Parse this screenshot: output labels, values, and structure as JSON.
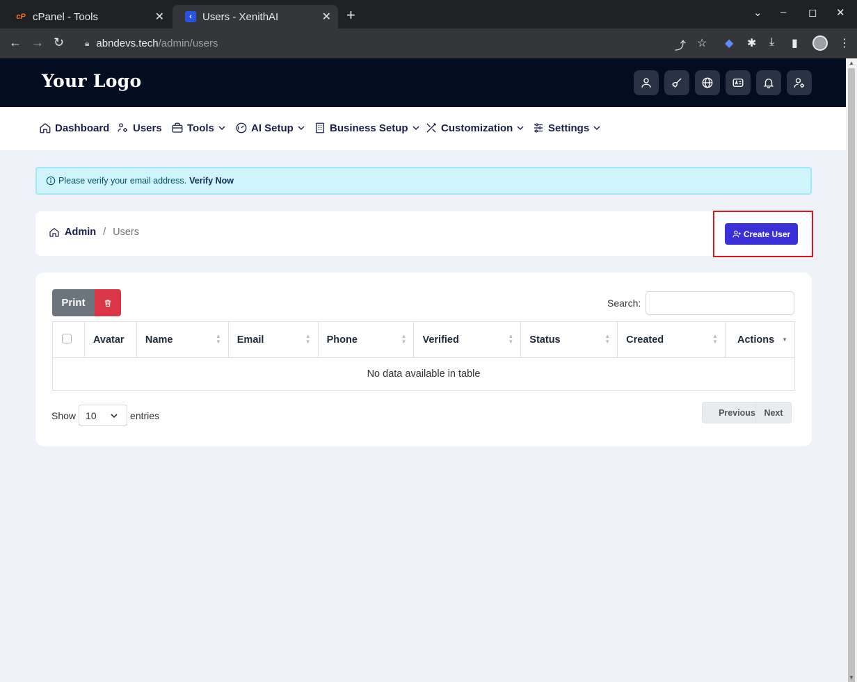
{
  "browser": {
    "tabs": [
      {
        "title": "cPanel - Tools",
        "favicon": "cpanel-icon"
      },
      {
        "title": "Users - XenithAI",
        "favicon": "xenith-icon"
      }
    ],
    "url_host": "abndevs.tech",
    "url_path": "/admin/users"
  },
  "header": {
    "logo": "Your Logo",
    "icons": [
      "user-icon",
      "broom-icon",
      "globe-icon",
      "language-icon",
      "bell-icon",
      "user-settings-icon"
    ]
  },
  "nav": {
    "items": [
      {
        "label": "Dashboard",
        "icon": "home-icon",
        "dropdown": false
      },
      {
        "label": "Users",
        "icon": "users-gear-icon",
        "dropdown": false
      },
      {
        "label": "Tools",
        "icon": "briefcase-icon",
        "dropdown": true
      },
      {
        "label": "AI Setup",
        "icon": "gauge-icon",
        "dropdown": true
      },
      {
        "label": "Business Setup",
        "icon": "building-icon",
        "dropdown": true
      },
      {
        "label": "Customization",
        "icon": "tools-icon",
        "dropdown": true
      },
      {
        "label": "Settings",
        "icon": "sliders-icon",
        "dropdown": true
      }
    ]
  },
  "alert": {
    "message": "Please verify your email address.",
    "link": "Verify Now"
  },
  "breadcrumb": {
    "root": "Admin",
    "separator": "/",
    "current": "Users"
  },
  "actions": {
    "create_user": "Create User"
  },
  "table": {
    "print_label": "Print",
    "search_label": "Search:",
    "search_value": "",
    "columns": [
      "Avatar",
      "Name",
      "Email",
      "Phone",
      "Verified",
      "Status",
      "Created",
      "Actions"
    ],
    "empty_message": "No data available in table",
    "show_label": "Show",
    "page_length": "10",
    "entries_label": "entries",
    "previous": "Previous",
    "next": "Next"
  },
  "colors": {
    "header_bg": "#020d22",
    "primary": "#3b30d8",
    "danger": "#dc3545",
    "highlight_border": "#e0161d",
    "alert_bg": "#cff4fc"
  }
}
